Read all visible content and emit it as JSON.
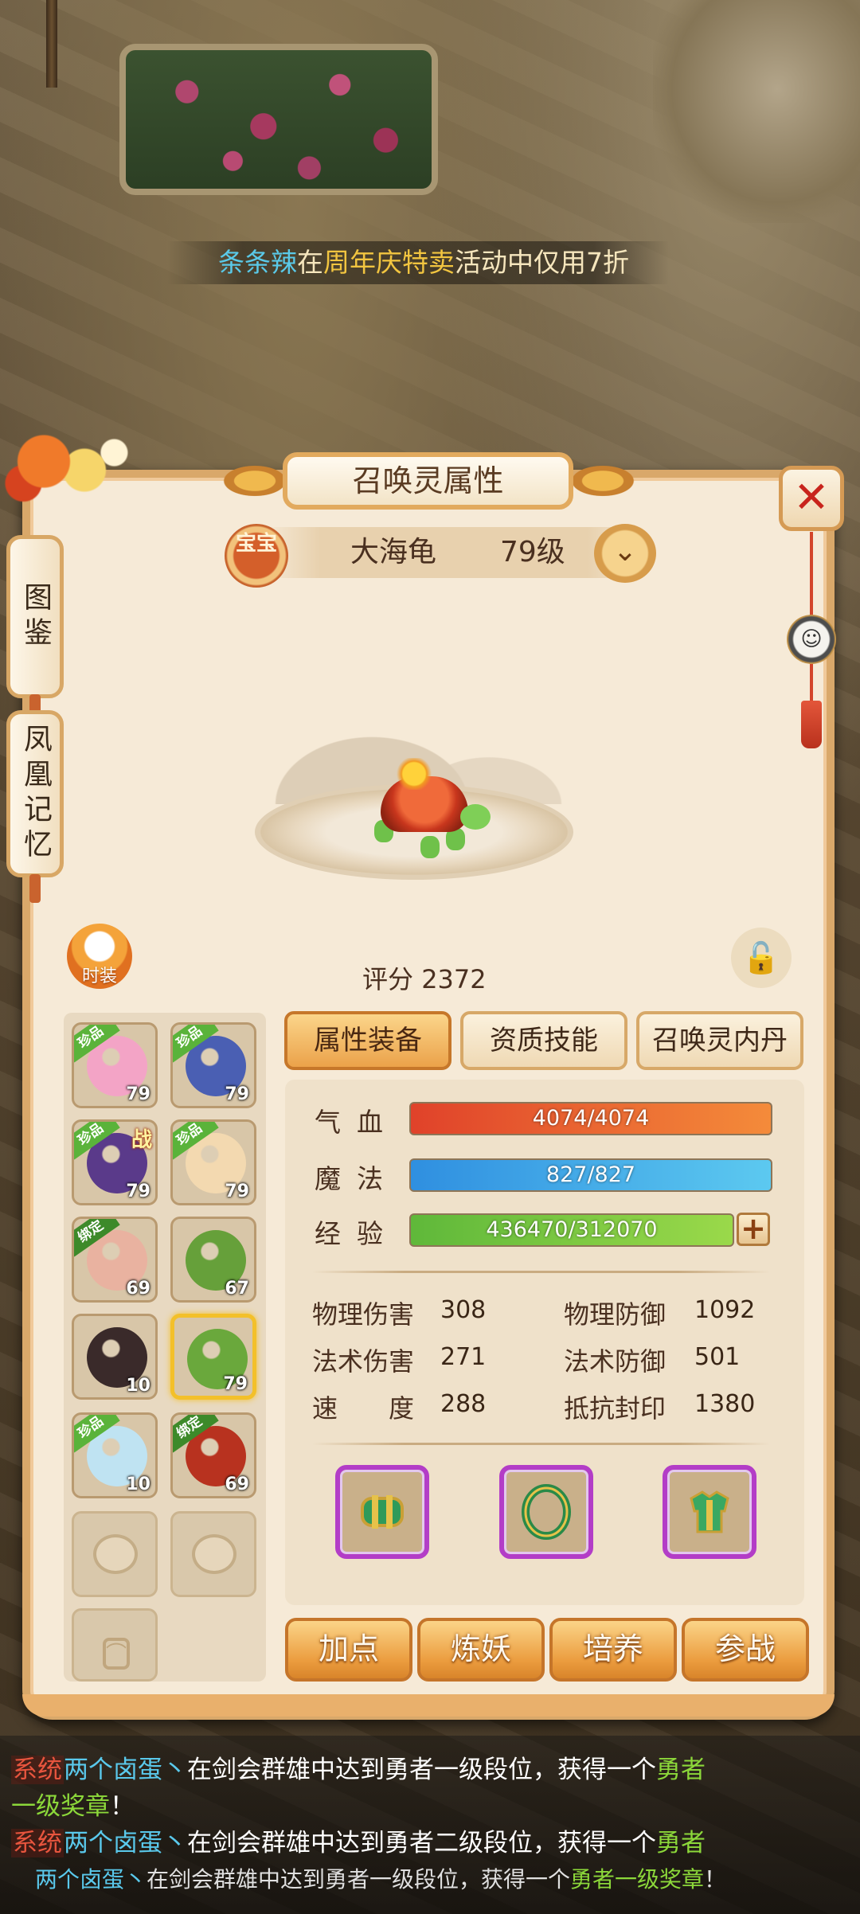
{
  "marquee": {
    "name": "条条辣",
    "in": "在",
    "event": "周年庆特卖",
    "rest": "活动中仅用7折"
  },
  "panel": {
    "title": "召唤灵属性",
    "close_label": "✕",
    "side_tabs": [
      "图鉴",
      "凤凰记忆"
    ],
    "baobao_badge": "宝宝",
    "pet_name": "大海龟",
    "pet_level": "79级",
    "dropdown_icon": "⌄",
    "fashion_label": "时装",
    "lock_icon": "🔓",
    "score_label": "评分",
    "score_value": "2372"
  },
  "pets": [
    {
      "level": "79",
      "tag": "珍品",
      "tag_type": "rare",
      "color": "#f3a4c6",
      "selected": false,
      "war": ""
    },
    {
      "level": "79",
      "tag": "珍品",
      "tag_type": "rare",
      "color": "#4a5fb3",
      "selected": false,
      "war": ""
    },
    {
      "level": "79",
      "tag": "珍品",
      "tag_type": "rare",
      "color": "#5a3a8a",
      "selected": false,
      "war": "战"
    },
    {
      "level": "79",
      "tag": "珍品",
      "tag_type": "rare",
      "color": "#f3d9b0",
      "selected": false,
      "war": ""
    },
    {
      "level": "69",
      "tag": "绑定",
      "tag_type": "bound",
      "color": "#e9b2a0",
      "selected": false,
      "war": ""
    },
    {
      "level": "67",
      "tag": "",
      "tag_type": "",
      "color": "#66a03a",
      "selected": false,
      "war": ""
    },
    {
      "level": "10",
      "tag": "",
      "tag_type": "",
      "color": "#3a2a2a",
      "selected": false,
      "war": ""
    },
    {
      "level": "79",
      "tag": "",
      "tag_type": "",
      "color": "#6aa83c",
      "selected": true,
      "war": ""
    },
    {
      "level": "10",
      "tag": "珍品",
      "tag_type": "rare",
      "color": "#bfe3f2",
      "selected": false,
      "war": ""
    },
    {
      "level": "69",
      "tag": "绑定",
      "tag_type": "bound",
      "color": "#b8321f",
      "selected": false,
      "war": ""
    }
  ],
  "tabs": [
    {
      "label": "属性装备",
      "active": true
    },
    {
      "label": "资质技能",
      "active": false
    },
    {
      "label": "召唤灵内丹",
      "active": false
    }
  ],
  "bars": [
    {
      "label": "气血",
      "text": "4074/4074",
      "fill": 1.0,
      "colors": [
        "#e0422a",
        "#f48b3a"
      ]
    },
    {
      "label": "魔法",
      "text": "827/827",
      "fill": 1.0,
      "colors": [
        "#2f8fe0",
        "#5cc9f0"
      ]
    },
    {
      "label": "经验",
      "text": "436470/312070",
      "fill": 1.0,
      "colors": [
        "#5fb83a",
        "#9ad94a"
      ]
    }
  ],
  "exp_plus": "+",
  "stats": [
    {
      "name": "物理伤害",
      "value": "308"
    },
    {
      "name": "物理防御",
      "value": "1092"
    },
    {
      "name": "法术伤害",
      "value": "271"
    },
    {
      "name": "法术防御",
      "value": "501"
    },
    {
      "name": "速　　度",
      "value": "288"
    },
    {
      "name": "抵抗封印",
      "value": "1380"
    }
  ],
  "equipment": [
    {
      "name": "bracer-icon",
      "color": "#2f9a5a"
    },
    {
      "name": "ring-icon",
      "color": "#2a8a48"
    },
    {
      "name": "armor-icon",
      "color": "#3aa862"
    }
  ],
  "actions": [
    "加点",
    "炼妖",
    "培养",
    "参战"
  ],
  "chat": [
    {
      "sys": "系统",
      "user": "两个卤蛋丶",
      "text": "在剑会群雄中达到勇者一级段位，获得一个",
      "reward": "勇者"
    },
    {
      "text": "",
      "reward": "一级奖章",
      "tail": "！"
    },
    {
      "sys": "系统",
      "user": "两个卤蛋丶",
      "text": "在剑会群雄中达到勇者二级段位，获得一个",
      "reward": "勇者"
    },
    {
      "user": "两个卤蛋丶",
      "text": "在剑会群雄中达到勇者一级段位，获得一个",
      "reward": "勇者一级奖章",
      "tail": "！"
    }
  ]
}
